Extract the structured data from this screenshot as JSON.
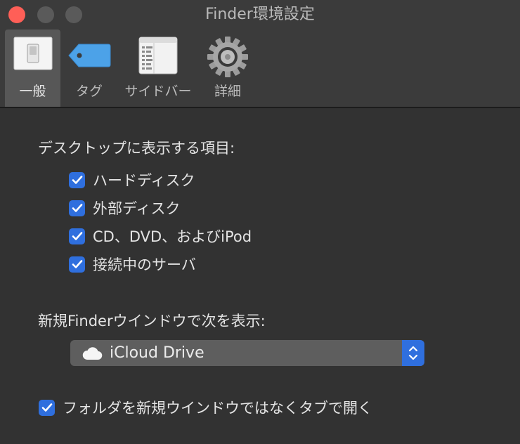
{
  "window": {
    "title": "Finder環境設定"
  },
  "tabs": [
    {
      "label": "一般",
      "icon": "switch-icon",
      "active": true
    },
    {
      "label": "タグ",
      "icon": "tag-icon",
      "active": false
    },
    {
      "label": "サイドバー",
      "icon": "sidebar-icon",
      "active": false
    },
    {
      "label": "詳細",
      "icon": "gear-icon",
      "active": false
    }
  ],
  "desktop_section": {
    "label": "デスクトップに表示する項目:",
    "items": [
      {
        "label": "ハードディスク",
        "checked": true
      },
      {
        "label": "外部ディスク",
        "checked": true
      },
      {
        "label": "CD、DVD、およびiPod",
        "checked": true
      },
      {
        "label": "接続中のサーバ",
        "checked": true
      }
    ]
  },
  "new_window_section": {
    "label": "新規Finderウインドウで次を表示:",
    "selected": "iCloud Drive",
    "selected_icon": "cloud-icon"
  },
  "tabs_option": {
    "label": "フォルダを新規ウインドウではなくタブで開く",
    "checked": true
  },
  "colors": {
    "accent": "#2f6fde",
    "background": "#323232",
    "toolbar": "#3b3b3b",
    "close": "#ff5f57"
  }
}
